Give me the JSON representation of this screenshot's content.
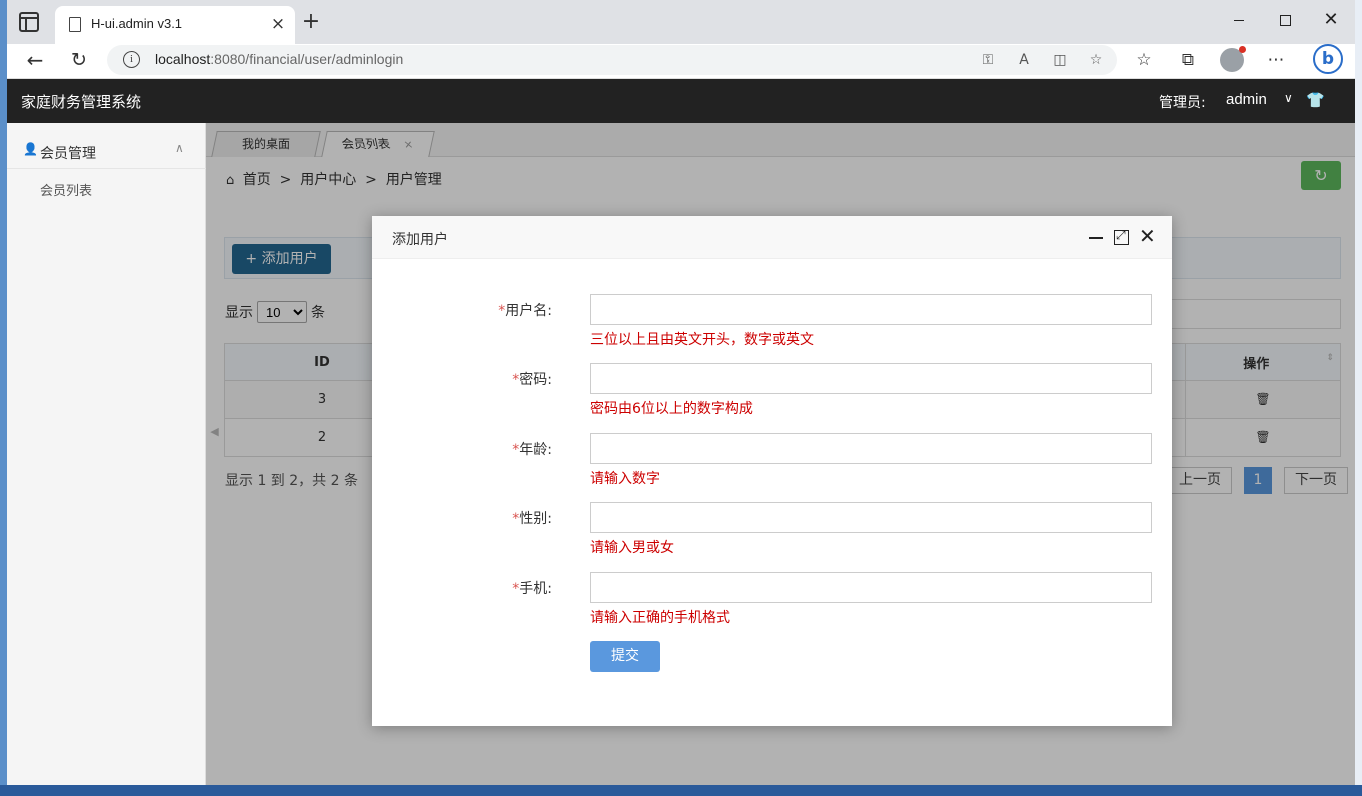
{
  "browser": {
    "tab_title": "H-ui.admin v3.1",
    "url_host": "localhost",
    "url_rest": ":8080/financial/user/adminlogin"
  },
  "app": {
    "title": "家庭财务管理系统",
    "role_label": "管理员:",
    "username": "admin"
  },
  "sidebar": {
    "menu_label": "会员管理",
    "sub_item": "会员列表"
  },
  "page_tabs": [
    {
      "label": "我的桌面"
    },
    {
      "label": "会员列表",
      "close": "×"
    }
  ],
  "breadcrumb": {
    "home": "首页",
    "sep": ">",
    "level2": "用户中心",
    "level3": "用户管理"
  },
  "toolbar": {
    "add_user": "添加用户"
  },
  "list": {
    "show_prefix": "显示",
    "page_size": "10",
    "show_suffix": "条",
    "columns": [
      "ID",
      "操作"
    ],
    "rows": [
      {
        "id": "3"
      },
      {
        "id": "2"
      }
    ],
    "info": "显示 1 到 2，共 2 条",
    "prev": "上一页",
    "current_page": "1",
    "next": "下一页"
  },
  "modal": {
    "title": "添加用户",
    "required_mark": "*",
    "fields": [
      {
        "label": "用户名:",
        "hint": "三位以上且由英文开头，数字或英文"
      },
      {
        "label": "密码:",
        "hint": "密码由6位以上的数字构成"
      },
      {
        "label": "年龄:",
        "hint": "请输入数字"
      },
      {
        "label": "性别:",
        "hint": "请输入男或女"
      },
      {
        "label": "手机:",
        "hint": "请输入正确的手机格式"
      }
    ],
    "submit": "提交"
  },
  "icons": {
    "brand_blue": "#236891",
    "refresh_green": "#5eb95e",
    "hint_red": "#cc0000",
    "submit_blue": "#5a98de"
  }
}
